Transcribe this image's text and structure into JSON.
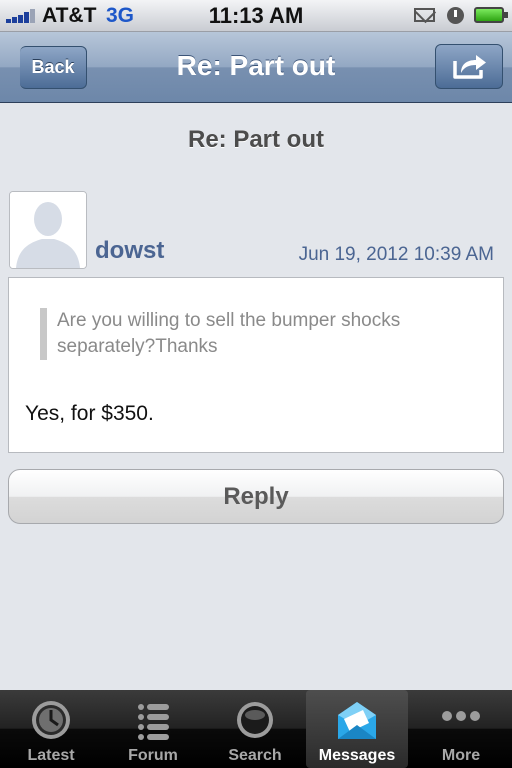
{
  "status_bar": {
    "carrier": "AT&T",
    "network": "3G",
    "time": "11:13 AM",
    "icons": [
      "signal-icon",
      "mail-icon",
      "alarm-icon",
      "battery-icon"
    ]
  },
  "nav_bar": {
    "back_label": "Back",
    "title": "Re: Part out",
    "share_icon": "share-icon"
  },
  "thread": {
    "heading": "Re: Part out",
    "post": {
      "author": "dowst",
      "timestamp": "Jun 19, 2012 10:39 AM",
      "quote": "Are you willing to sell the bumper shocks separately?Thanks",
      "body": "Yes, for $350."
    },
    "reply_label": "Reply"
  },
  "tab_bar": {
    "tabs": [
      {
        "label": "Latest",
        "icon": "clock-icon",
        "active": false
      },
      {
        "label": "Forum",
        "icon": "list-icon",
        "active": false
      },
      {
        "label": "Search",
        "icon": "search-icon",
        "active": false
      },
      {
        "label": "Messages",
        "icon": "envelope-icon",
        "active": true
      },
      {
        "label": "More",
        "icon": "more-icon",
        "active": false
      }
    ]
  },
  "colors": {
    "nav_blue": "#6d87a9",
    "link_blue": "#4b6592",
    "background": "#e3e6eb",
    "active_tab_icon": "#2aa7e8"
  }
}
